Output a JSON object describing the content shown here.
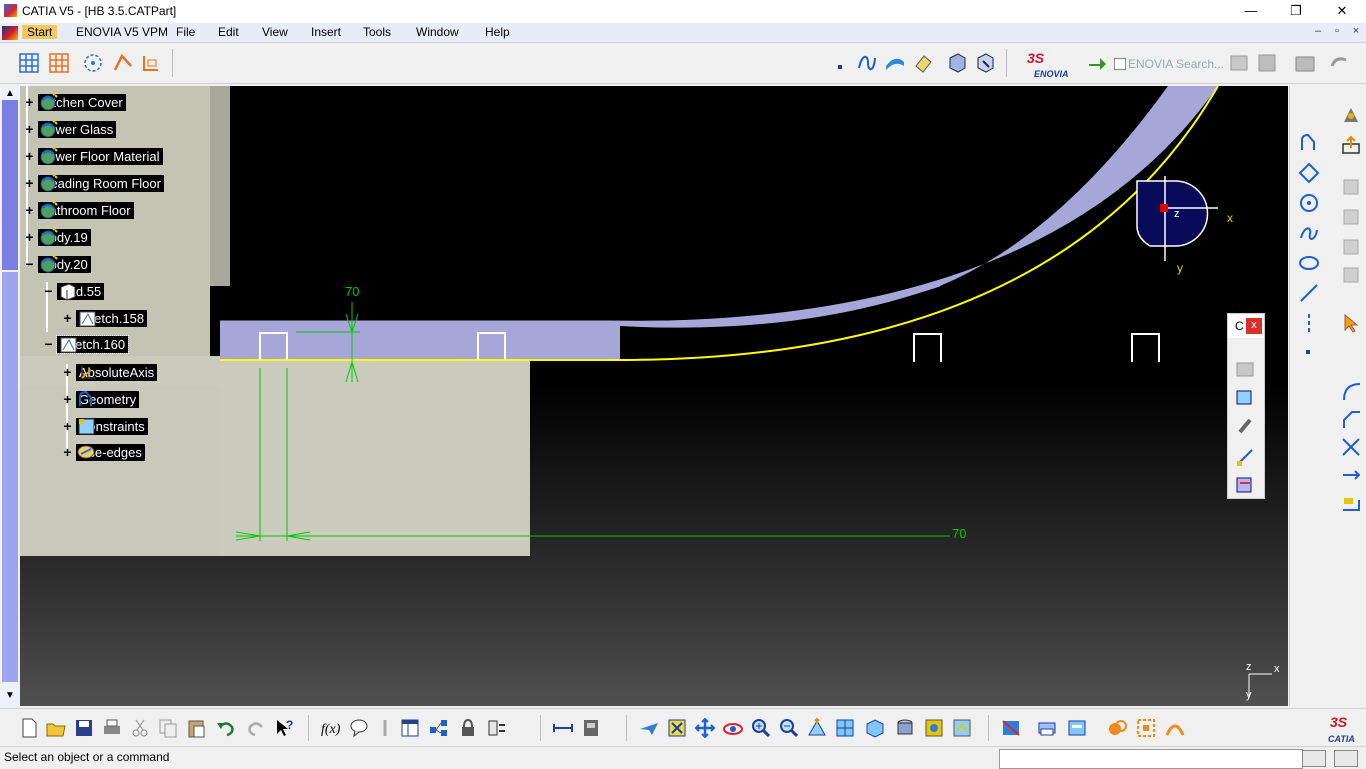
{
  "window": {
    "title": "CATIA V5 - [HB 3.5.CATPart]",
    "minimize": "—",
    "maximize": "❐",
    "close": "✕"
  },
  "menu": {
    "items": [
      "Start",
      "ENOVIA V5 VPM",
      "File",
      "Edit",
      "View",
      "Insert",
      "Tools",
      "Window",
      "Help"
    ],
    "mdi": [
      "–",
      "▫",
      "×"
    ]
  },
  "toolbar": {
    "enovia_search": "ENOVIA Search...",
    "enovia_logo": "ENOVIA"
  },
  "tree": {
    "items": [
      {
        "label": "Kitchen Cover",
        "icon": "body-icon"
      },
      {
        "label": "Lower Glass",
        "icon": "body-icon"
      },
      {
        "label": "Lower Floor Material",
        "icon": "body-icon"
      },
      {
        "label": "Reading Room Floor",
        "icon": "body-icon"
      },
      {
        "label": "Bathroom Floor",
        "icon": "body-icon"
      },
      {
        "label": "Body.19",
        "icon": "body-icon"
      },
      {
        "label": "Body.20",
        "icon": "body-icon"
      },
      {
        "label": "Pad.55",
        "icon": "pad-icon"
      },
      {
        "label": "Sketch.158",
        "icon": "sketch-icon"
      },
      {
        "label": "Sketch.160",
        "icon": "sketch-icon"
      },
      {
        "label": "AbsoluteAxis",
        "icon": "axis-icon"
      },
      {
        "label": "Geometry",
        "icon": "geometry-icon"
      },
      {
        "label": "Constraints",
        "icon": "constraints-icon"
      },
      {
        "label": "Use-edges",
        "icon": "use-edges-icon"
      }
    ]
  },
  "viewport": {
    "dimension_vertical": "70",
    "dimension_horizontal": "70",
    "compass_z": "z",
    "compass_x": "x",
    "compass_y": "y",
    "axis_z": "z",
    "axis_x": "x",
    "axis_y": "y"
  },
  "floating_toolbar": {
    "title": "C",
    "close": "x"
  },
  "status": {
    "message": "Select an object or a command"
  },
  "colors": {
    "sketch_green": "#00c800",
    "profile_fill": "#a6a6d8",
    "highlight_yellow": "#ffff00",
    "tree_label_bg": "#000000"
  },
  "brand": {
    "catia_logo": "CATIA"
  }
}
